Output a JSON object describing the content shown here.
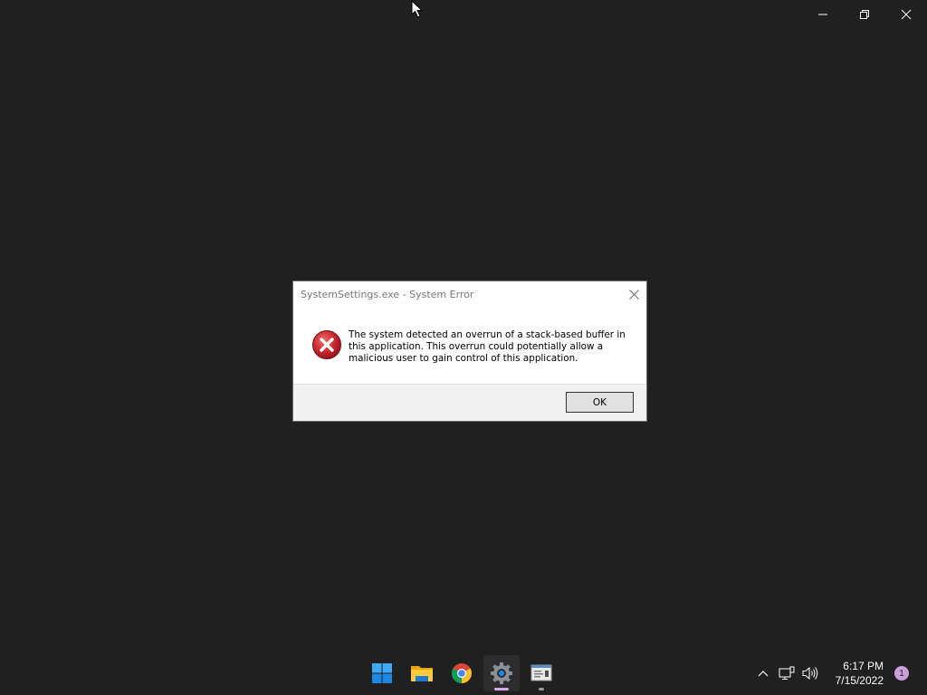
{
  "window": {
    "minimize_icon": "minimize-icon",
    "restore_icon": "restore-icon",
    "close_icon": "close-icon"
  },
  "dialog": {
    "title": "SystemSettings.exe - System Error",
    "message": "The system detected an overrun of a stack-based buffer in this application. This overrun could potentially allow a malicious user to gain control of this application.",
    "icon": "error-icon",
    "ok_label": "OK"
  },
  "taskbar": {
    "apps": [
      {
        "name": "start",
        "icon": "windows-logo-icon",
        "state": "none"
      },
      {
        "name": "file-explorer",
        "icon": "folder-icon",
        "state": "none"
      },
      {
        "name": "chrome",
        "icon": "chrome-icon",
        "state": "none"
      },
      {
        "name": "settings",
        "icon": "gear-icon",
        "state": "active"
      },
      {
        "name": "app",
        "icon": "app-window-icon",
        "state": "running"
      }
    ],
    "tray": {
      "chevron_icon": "chevron-up-icon",
      "network_icon": "network-icon",
      "volume_icon": "volume-icon",
      "time": "6:17 PM",
      "date": "7/15/2022",
      "notification_count": "1"
    }
  },
  "colors": {
    "desktop": "#202020",
    "accent": "#c9a0dc",
    "error_red": "#c4262e"
  }
}
